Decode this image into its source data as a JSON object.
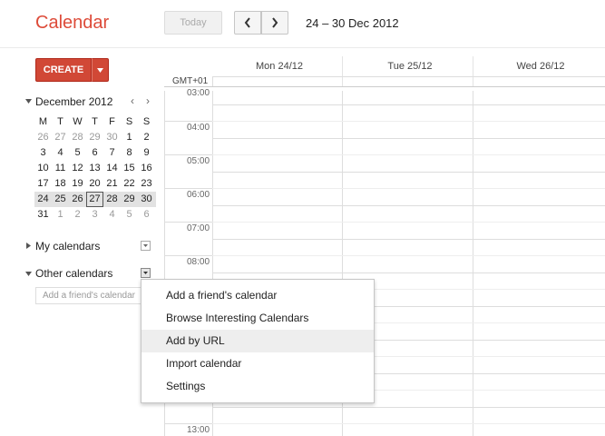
{
  "header": {
    "title": "Calendar",
    "today_label": "Today",
    "date_range": "24 – 30 Dec 2012"
  },
  "create": {
    "label": "CREATE"
  },
  "mini_calendar": {
    "month_label": "December 2012",
    "weekdays": [
      "M",
      "T",
      "W",
      "T",
      "F",
      "S",
      "S"
    ],
    "weeks": [
      [
        "26",
        "27",
        "28",
        "29",
        "30",
        "1",
        "2"
      ],
      [
        "3",
        "4",
        "5",
        "6",
        "7",
        "8",
        "9"
      ],
      [
        "10",
        "11",
        "12",
        "13",
        "14",
        "15",
        "16"
      ],
      [
        "17",
        "18",
        "19",
        "20",
        "21",
        "22",
        "23"
      ],
      [
        "24",
        "25",
        "26",
        "27",
        "28",
        "29",
        "30"
      ],
      [
        "31",
        "1",
        "2",
        "3",
        "4",
        "5",
        "6"
      ]
    ]
  },
  "sidebar": {
    "my_calendars": "My calendars",
    "other_calendars": "Other calendars",
    "friend_placeholder": "Add a friend's calendar"
  },
  "grid": {
    "timezone": "GMT+01",
    "days": [
      "Mon 24/12",
      "Tue 25/12",
      "Wed 26/12"
    ],
    "times": [
      "03:00",
      "04:00",
      "05:00",
      "06:00",
      "07:00",
      "08:00",
      "13:00"
    ]
  },
  "menu": {
    "items": [
      "Add a friend's calendar",
      "Browse Interesting Calendars",
      "Add by URL",
      "Import calendar",
      "Settings"
    ]
  }
}
